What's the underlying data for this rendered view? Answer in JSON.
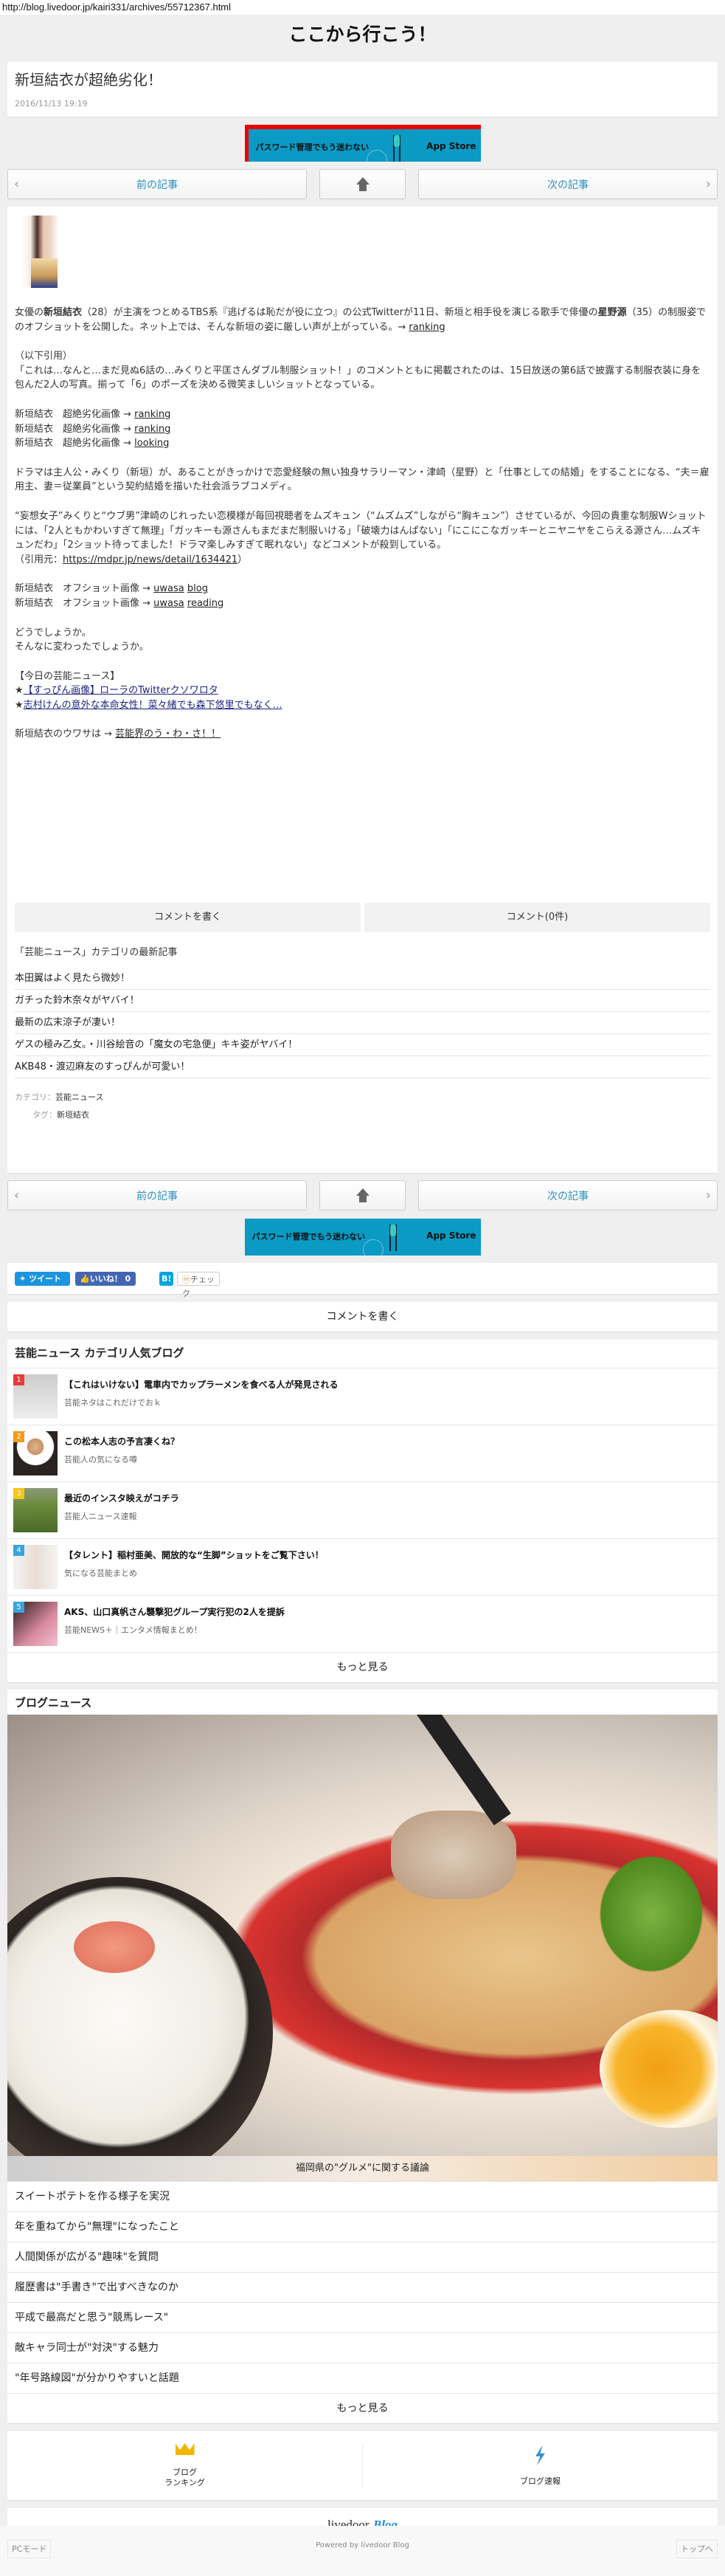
{
  "url": "http://blog.livedoor.jp/kairi331/archives/55712367.html",
  "site_title": "ここから行こう！",
  "article": {
    "title": "新垣結衣が超絶劣化！",
    "date": "2016/11/13 19:19",
    "p1_a": "女優の",
    "p1_name1": "新垣結衣",
    "p1_b": "（28）が主演をつとめるTBS系『逃げるは恥だが役に立つ』の公式Twitterが11日、新垣と相手役を演じる歌手で俳優の",
    "p1_name2": "星野源",
    "p1_c": "（35）の制服姿でのオフショットを公開した。ネット上では、そんな新垣の姿に厳しい声が上がっている。→ ",
    "p1_link": "ranking",
    "quote_head": "（以下引用）",
    "quote1": "「これは…なんと…まだ見ぬ6話の…みくりと平匡さんダブル制服ショット！」のコメントともに掲載されたのは、15日放送の第6話で披露する制服衣装に身を包んだ2人の写真。揃って「6」のポーズを決める微笑ましいショットとなっている。",
    "links1": [
      {
        "text": "新垣結衣　超絶劣化画像 → ",
        "link": "ranking"
      },
      {
        "text": "新垣結衣　超絶劣化画像 → ",
        "link": "ranking"
      },
      {
        "text": "新垣結衣　超絶劣化画像 → ",
        "link": "looking"
      }
    ],
    "drama": "ドラマは主人公・みくり（新垣）が、あることがきっかけで恋愛経験の無い独身サラリーマン・津崎（星野）と「仕事としての結婚」をすることになる、“夫＝雇用主、妻＝従業員”という契約結婚を描いた社会派ラブコメディ。",
    "moso": "“妄想女子”みくりと“ウブ男”津崎のじれったい恋模様が毎回視聴者をムズキュン（“ムズムズ”しながら“胸キュン”）させているが、今回の貴重な制服Wショットには、「2人ともかわいすぎて無理」「ガッキーも源さんもまだまだ制服いける」「破壊力はんぱない」「にこにこなガッキーとニヤニヤをこらえる源さん…ムズキュンだわ」「2ショット待ってました！ドラマ楽しみすぎて眠れない」などコメントが殺到している。",
    "source_pre": "（引用元：",
    "source_link": "https://mdpr.jp/news/detail/1634421",
    "source_post": "）",
    "offshot": [
      {
        "text": "新垣結衣　オフショット画像 → ",
        "l1": "uwasa",
        "l2": "blog"
      },
      {
        "text": "新垣結衣　オフショット画像 → ",
        "l1": "uwasa",
        "l2": "reading"
      }
    ],
    "closing1": "どうでしょうか。",
    "closing2": "そんなに変わったでしょうか。",
    "today_head": "【今日の芸能ニュース】",
    "today": [
      {
        "star": "★",
        "link": "【すっぴん画像】ローラのTwitterクソワロタ"
      },
      {
        "star": "★",
        "link": "志村けんの意外な本命女性！菜々緒でも森下悠里でもなく…"
      }
    ],
    "uwasa_pre": "新垣結衣のウワサは → ",
    "uwasa_link": "芸能界のう・わ・さ！！"
  },
  "nav": {
    "prev": "前の記事",
    "next": "次の記事"
  },
  "ad": {
    "text": "パスワード管理でもう迷わない",
    "store": " App Store"
  },
  "comments": {
    "write": "コメントを書く",
    "count": "コメント(0件)"
  },
  "related": {
    "heading": "「芸能ニュース」カテゴリの最新記事",
    "items": [
      "本田翼はよく見たら微妙！",
      "ガチった鈴木奈々がヤバイ！",
      "最新の広末涼子が凄い！",
      "ゲスの極み乙女。・川谷絵音の「魔女の宅急便」キキ姿がヤバイ！",
      "AKB48・渡辺麻友のすっぴんが可愛い！"
    ]
  },
  "meta": {
    "cat_label": "カテゴリ：",
    "cat": "芸能ニュース",
    "tag_label": "タグ：",
    "tag": "新垣結衣"
  },
  "share": {
    "tweet": "ツイート",
    "like": "いいね！ 0",
    "hatena": "B!",
    "check": "チェック"
  },
  "popular": {
    "heading": "芸能ニュース カテゴリ人気ブログ",
    "more": "もっと見る",
    "items": [
      {
        "rank": "1",
        "color": "#e8393a",
        "title": "【これはいけない】電車内でカップラーメンを食べる人が発見される",
        "blog": "芸能ネタはこれだけでおｋ"
      },
      {
        "rank": "2",
        "color": "#f39a1e",
        "title": "この松本人志の予言凄くね？",
        "blog": "芸能人の気になる噂"
      },
      {
        "rank": "3",
        "color": "#f5c518",
        "title": "最近のインスタ映えがコチラ",
        "blog": "芸能人ニュース速報"
      },
      {
        "rank": "4",
        "color": "#3aa3dc",
        "title": "【タレント】稲村亜美、開放的な“生脚”ショットをご覧下さい！",
        "blog": "気になる芸能まとめ"
      },
      {
        "rank": "5",
        "color": "#3aa3dc",
        "title": "AKS、山口真帆さん襲撃犯グループ実行犯の2人を提訴",
        "blog": "芸能NEWS＋｜エンタメ情報まとめ！"
      }
    ]
  },
  "blognews": {
    "heading": "ブログニュース",
    "caption": "福岡県の\"グルメ\"に関する議論",
    "items": [
      "スイートポテトを作る様子を実況",
      "年を重ねてから\"無理\"になったこと",
      "人間関係が広がる\"趣味\"を質問",
      "履歴書は\"手書き\"で出すべきなのか",
      "平成で最高だと思う\"競馬レース\"",
      "敵キャラ同士が\"対決\"する魅力",
      "\"年号路線図\"が分かりやすいと話題"
    ],
    "more": "もっと見る"
  },
  "links": {
    "ranking_1": "ブログ",
    "ranking_2": "ランキング",
    "sokuho": "ブログ速報"
  },
  "logo": {
    "a": "livedoor",
    "b": "Blog"
  },
  "footer": {
    "pc": "PCモード",
    "powered": "Powered by livedoor Blog",
    "top": "トップへ"
  }
}
